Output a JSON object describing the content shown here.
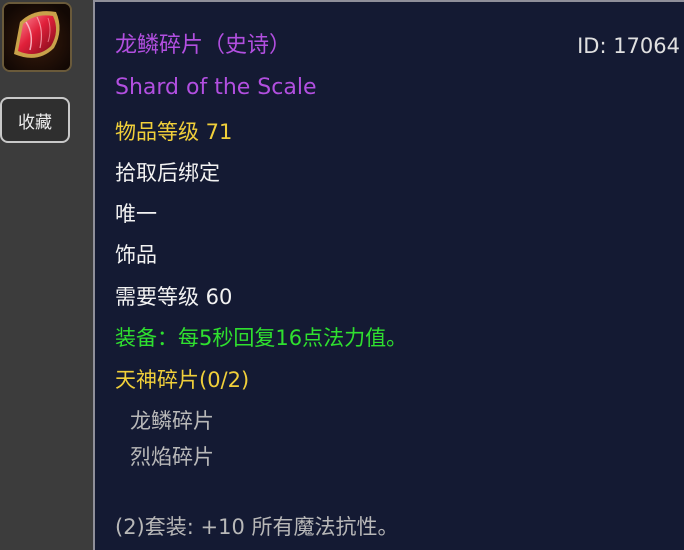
{
  "sidebar": {
    "collect_label": "收藏"
  },
  "item": {
    "icon": "dragon-scale-shard-icon",
    "name_cn": "龙鳞碎片（史诗）",
    "name_en": "Shard of the Scale",
    "id_label": "ID: 17064",
    "item_level": "物品等级 71",
    "binding": "拾取后绑定",
    "unique": "唯一",
    "slot": "饰品",
    "required_level": "需要等级 60",
    "equip_effect": "装备：每5秒回复16点法力值。",
    "set_name": "天神碎片(0/2)",
    "set_pieces": [
      "龙鳞碎片",
      "烈焰碎片"
    ],
    "set_bonus": "(2)套装: +10 所有魔法抗性。"
  },
  "colors": {
    "epic": "#b24fe0",
    "item_level": "#f0cf3a",
    "equip": "#2fe02f",
    "set_inactive": "#b8b8b8",
    "tooltip_bg": "#141a33"
  }
}
